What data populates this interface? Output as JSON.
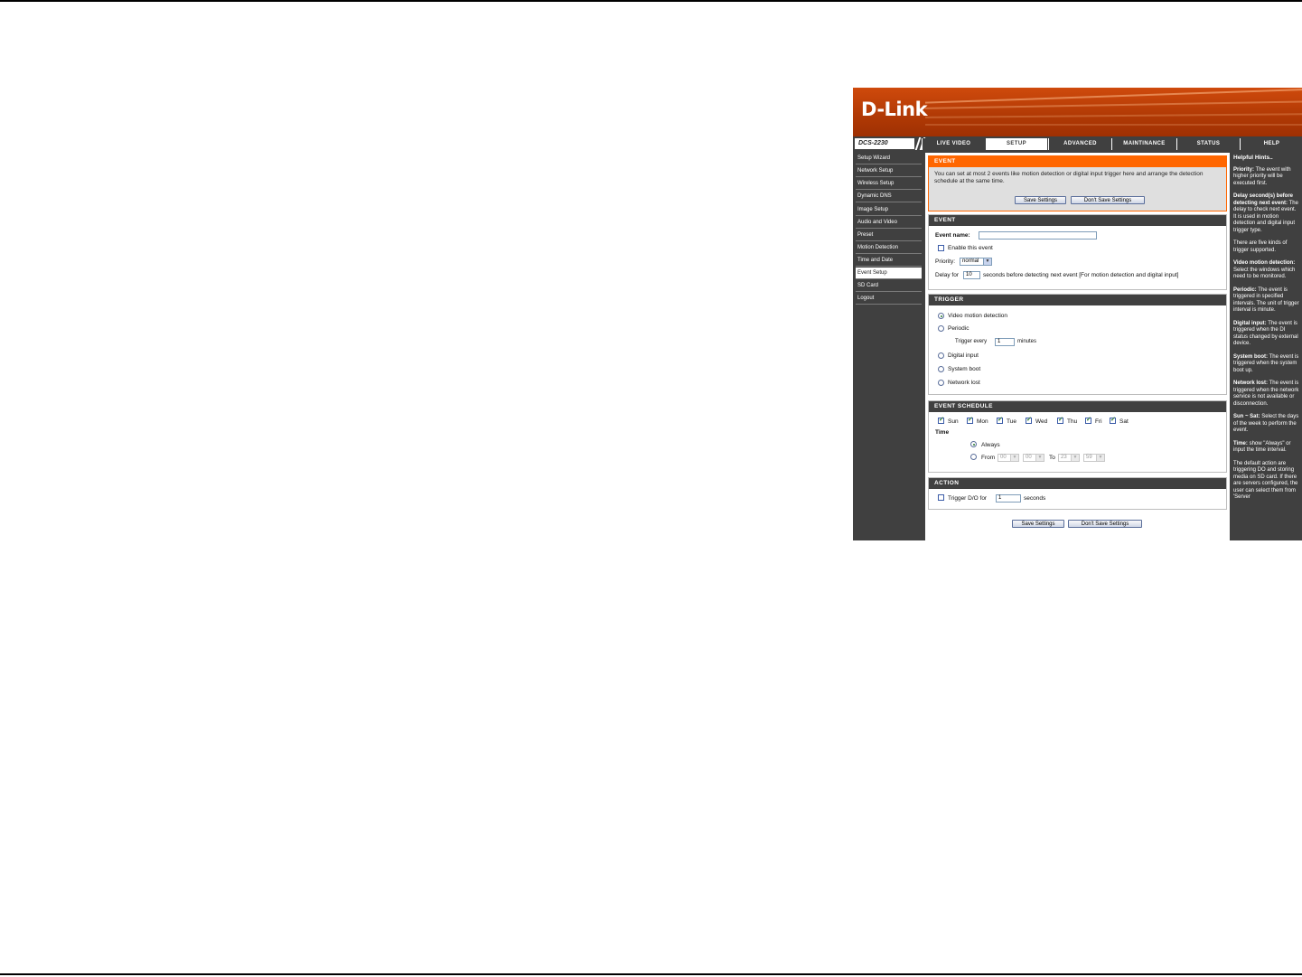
{
  "brand": {
    "logo": "D-Link",
    "model": "DCS-2230"
  },
  "nav": {
    "tabs": [
      {
        "label": "LIVE VIDEO"
      },
      {
        "label": "SETUP"
      },
      {
        "label": "ADVANCED"
      },
      {
        "label": "MAINTINANCE"
      },
      {
        "label": "STATUS"
      },
      {
        "label": "HELP"
      }
    ],
    "active": "SETUP"
  },
  "sidebar": {
    "items": [
      {
        "label": "Setup Wizard"
      },
      {
        "label": "Network Setup"
      },
      {
        "label": "Wireless Setup"
      },
      {
        "label": "Dynamic DNS"
      },
      {
        "label": "Image Setup"
      },
      {
        "label": "Audio and Video"
      },
      {
        "label": "Preset"
      },
      {
        "label": "Motion Detection"
      },
      {
        "label": "Time and Date"
      },
      {
        "label": "Event Setup"
      },
      {
        "label": "SD Card"
      },
      {
        "label": "Logout"
      }
    ],
    "active": "Event Setup"
  },
  "intro": {
    "title": "EVENT",
    "text": "You can set at most 2 events like motion detection or digital input trigger here and arrange the detection schedule at the same time.",
    "save_label": "Save Settings",
    "dont_save_label": "Don't Save Settings"
  },
  "event": {
    "title": "EVENT",
    "name_label": "Event name:",
    "name_value": "",
    "enable_label": "Enable this event",
    "enable_checked": false,
    "priority_label": "Priority:",
    "priority_value": "normal",
    "delay_prefix": "Delay for",
    "delay_value": "10",
    "delay_suffix": "seconds before detecting next event [For motion detection and digital input]"
  },
  "trigger": {
    "title": "TRIGGER",
    "options": [
      {
        "label": "Video motion detection",
        "checked": true
      },
      {
        "label": "Periodic",
        "checked": false
      },
      {
        "label": "Digital input",
        "checked": false
      },
      {
        "label": "System boot",
        "checked": false
      },
      {
        "label": "Network lost",
        "checked": false
      }
    ],
    "every_prefix": "Trigger every",
    "every_value": "1",
    "every_suffix": "minutes"
  },
  "schedule": {
    "title": "EVENT SCHEDULE",
    "days": [
      {
        "label": "Sun",
        "checked": true
      },
      {
        "label": "Mon",
        "checked": true
      },
      {
        "label": "Tue",
        "checked": true
      },
      {
        "label": "Wed",
        "checked": true
      },
      {
        "label": "Thu",
        "checked": true
      },
      {
        "label": "Fri",
        "checked": true
      },
      {
        "label": "Sat",
        "checked": true
      }
    ],
    "time_label": "Time",
    "always_label": "Always",
    "always_checked": true,
    "from_label": "From",
    "from_hour": "00",
    "from_min": "00",
    "to_label": "To",
    "to_hour": "23",
    "to_min": "59"
  },
  "action": {
    "title": "ACTION",
    "trigger_label": "Trigger D/O for",
    "trigger_value": "1",
    "trigger_suffix": "seconds",
    "checked": false
  },
  "footer": {
    "save_label": "Save Settings",
    "dont_save_label": "Don't Save Settings"
  },
  "help": {
    "title": "Helpful Hints..",
    "items": [
      {
        "term": "Priority:",
        "text": "The event with higher priority will be executed first."
      },
      {
        "term": "Delay second(s) before detecting next event:",
        "text": "The delay to check next event. It is used in motion detection and digital input trigger type."
      },
      {
        "term": "",
        "text": "There are five kinds of trigger supported."
      },
      {
        "term": "Video motion detection:",
        "text": "Select the windows which need to be monitored."
      },
      {
        "term": "Periodic:",
        "text": "The event is triggered in specified intervals. The unit of trigger interval is minute."
      },
      {
        "term": "Digital input:",
        "text": "The event is triggered when the DI status changed by external device."
      },
      {
        "term": "System boot:",
        "text": "The event is triggered when the system boot up."
      },
      {
        "term": "Network lost:",
        "text": "The event is triggered when the network service is not available or disconnection."
      },
      {
        "term": "Sun ~ Sat:",
        "text": "Select the days of the week to perform the event."
      },
      {
        "term": "Time:",
        "text": "show \"Always\" or input the time interval."
      },
      {
        "term": "",
        "text": "The default action are triggering DO and storing media on SD card. If there are servers configured, the user can select them from 'Server"
      }
    ]
  },
  "colors": {
    "accent": "#ff6600",
    "banner": "#c0440a",
    "nav_bg": "#404040"
  }
}
